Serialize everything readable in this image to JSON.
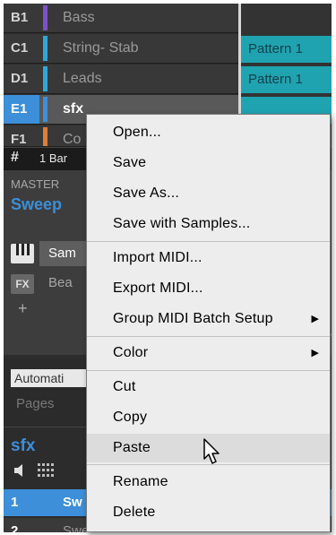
{
  "groups": [
    {
      "id": "B1",
      "name": "Bass",
      "color": "#7a52c9"
    },
    {
      "id": "C1",
      "name": "String- Stab",
      "color": "#2fa7d8"
    },
    {
      "id": "D1",
      "name": "Leads",
      "color": "#2fa7d8"
    },
    {
      "id": "E1",
      "name": "sfx",
      "color": "#3c8fd8"
    },
    {
      "id": "F1",
      "name": "Co",
      "color": "#e07d3a"
    }
  ],
  "patterns": [
    "Pattern 1",
    "Pattern 1"
  ],
  "toolbar": {
    "grid_icon": "#",
    "bar_label": "1 Bar"
  },
  "master": {
    "label": "MASTER",
    "sound_name": "Sweep",
    "slots": [
      "Sam",
      "Bea"
    ],
    "fx_label": "FX",
    "plus": "+",
    "right_clip": "y"
  },
  "automation": {
    "tab_label": "Automati",
    "pages_label": "Pages"
  },
  "group_panel": {
    "name": "sfx",
    "pads": [
      {
        "id": "1",
        "name": "Sw"
      },
      {
        "id": "2",
        "name": "Sweep Layers..."
      }
    ]
  },
  "context_menu": {
    "items": [
      {
        "label": "Open..."
      },
      {
        "label": "Save"
      },
      {
        "label": "Save As..."
      },
      {
        "label": "Save with Samples..."
      },
      {
        "label": "Import MIDI..."
      },
      {
        "label": "Export MIDI..."
      },
      {
        "label": "Group MIDI Batch Setup"
      },
      {
        "label": "Color"
      },
      {
        "label": "Cut"
      },
      {
        "label": "Copy"
      },
      {
        "label": "Paste"
      },
      {
        "label": "Rename"
      },
      {
        "label": "Delete"
      }
    ],
    "submenu_arrow": "▶",
    "hovered_item": "Paste"
  },
  "colors": {
    "accent": "#3c8fd8",
    "pattern": "#1fa3b0",
    "menu_bg": "#ededed"
  }
}
